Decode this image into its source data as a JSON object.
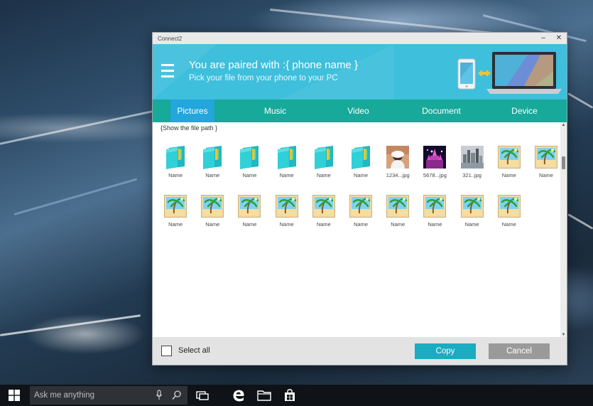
{
  "window": {
    "title": "Connect2",
    "minimize_glyph": "–",
    "close_glyph": "✕"
  },
  "header": {
    "paired_text": "You are paired with :{ phone name }",
    "instruction": "Pick your file from your phone to your PC",
    "icons": [
      "menu-icon",
      "phone-to-laptop-icon"
    ]
  },
  "tabs": [
    {
      "label": "Pictures",
      "active": true
    },
    {
      "label": "Music",
      "active": false
    },
    {
      "label": "Video",
      "active": false
    },
    {
      "label": "Document",
      "active": false
    },
    {
      "label": "Device",
      "active": false
    }
  ],
  "file_path": "{Show the file path }",
  "items": [
    {
      "type": "folder",
      "label": "Name"
    },
    {
      "type": "folder",
      "label": "Name"
    },
    {
      "type": "folder",
      "label": "Name"
    },
    {
      "type": "folder",
      "label": "Name"
    },
    {
      "type": "folder",
      "label": "Name"
    },
    {
      "type": "folder",
      "label": "Name"
    },
    {
      "type": "photo-person",
      "label": "1234...jpg"
    },
    {
      "type": "photo-castle",
      "label": "5678...jpg"
    },
    {
      "type": "photo-city",
      "label": "321..jpg"
    },
    {
      "type": "image",
      "label": "Name"
    },
    {
      "type": "image",
      "label": "Name"
    },
    {
      "type": "image",
      "label": "Name"
    },
    {
      "type": "image",
      "label": "Name"
    },
    {
      "type": "image",
      "label": "Name"
    },
    {
      "type": "image",
      "label": "Name"
    },
    {
      "type": "image",
      "label": "Name"
    },
    {
      "type": "image",
      "label": "Name"
    },
    {
      "type": "image",
      "label": "Name"
    },
    {
      "type": "image",
      "label": "Name"
    },
    {
      "type": "image",
      "label": "Name"
    },
    {
      "type": "image",
      "label": "Name"
    }
  ],
  "footer": {
    "select_all_label": "Select all",
    "select_all_checked": false,
    "copy_label": "Copy",
    "cancel_label": "Cancel"
  },
  "taskbar": {
    "search_placeholder": "Ask me anything",
    "icons": [
      "windows-start-icon",
      "microphone-icon",
      "search-icon",
      "task-view-icon",
      "edge-browser-icon",
      "file-explorer-icon",
      "store-icon"
    ]
  },
  "colors": {
    "header_bg": "#3ebfdc",
    "tab_bar_bg": "#17a99a",
    "active_tab_bg": "#22a6dc",
    "copy_button": "#1aacc0",
    "cancel_button": "#9a9a9a"
  }
}
